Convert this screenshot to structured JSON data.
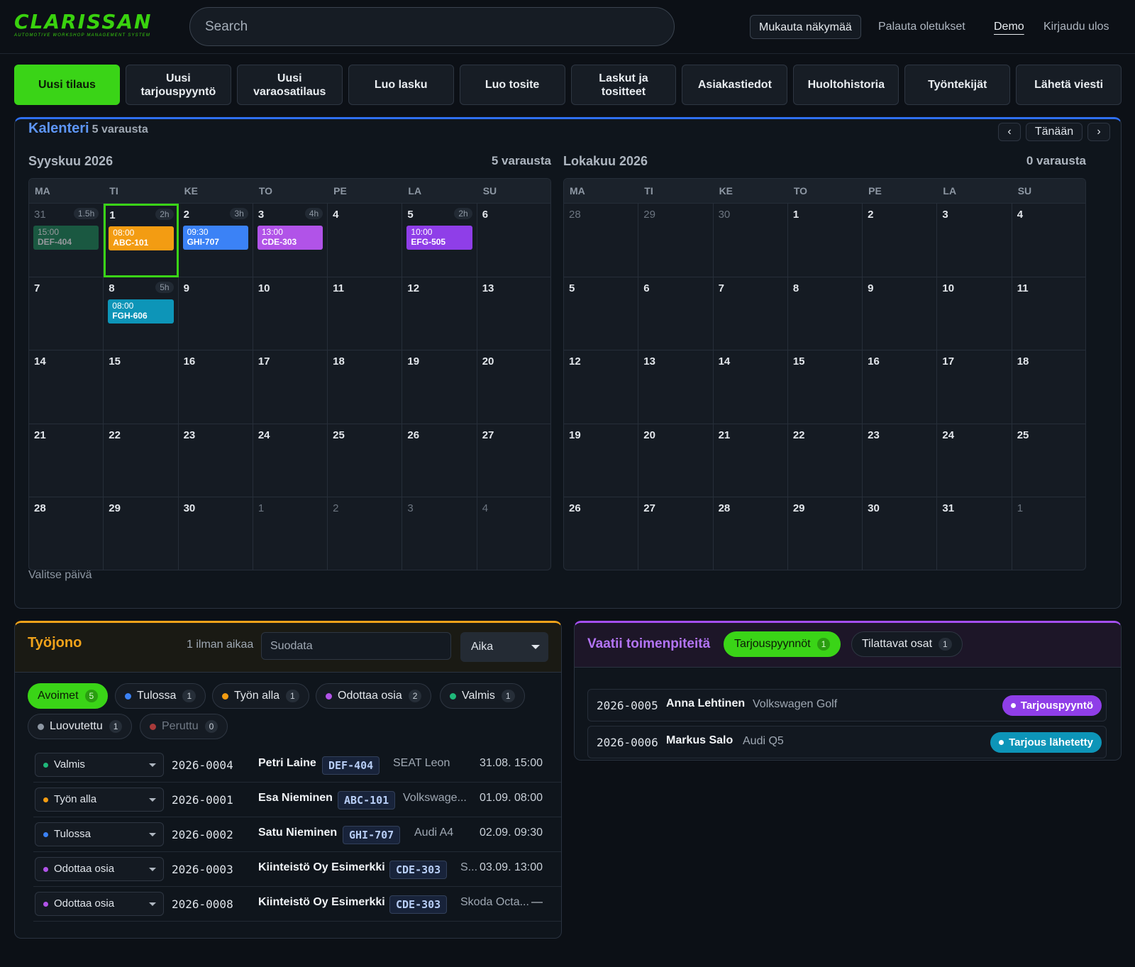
{
  "header": {
    "logo_text": "CLARISSAN",
    "logo_sub": "AUTOMOTIVE WORKSHOP MANAGEMENT SYSTEM",
    "search_placeholder": "Search",
    "customize_label": "Mukauta näkymää",
    "reset_label": "Palauta oletukset",
    "user_label": "Demo",
    "logout_label": "Kirjaudu ulos"
  },
  "actions": [
    "Uusi tilaus",
    "Uusi\ntarjouspyyntö",
    "Uusi\nvaraosatilaus",
    "Luo lasku",
    "Luo tosite",
    "Laskut ja\ntositteet",
    "Asiakastiedot",
    "Huoltohistoria",
    "Työntekijät",
    "Lähetä viesti"
  ],
  "calendar": {
    "title": "Kalenteri",
    "count_label": "5 varausta",
    "prev_label": "‹",
    "today_label": "Tänään",
    "next_label": "›",
    "weekdays": [
      "MA",
      "TI",
      "KE",
      "TO",
      "PE",
      "LA",
      "SU"
    ],
    "footer": "Valitse päivä",
    "months": [
      {
        "name": "Syyskuu 2026",
        "count": "5 varausta",
        "days": [
          "31",
          "1",
          "2",
          "3",
          "4",
          "5",
          "6",
          "7",
          "8",
          "9",
          "10",
          "11",
          "12",
          "13",
          "14",
          "15",
          "16",
          "17",
          "18",
          "19",
          "20",
          "21",
          "22",
          "23",
          "24",
          "25",
          "26",
          "27",
          "28",
          "29",
          "30",
          "1",
          "2",
          "3",
          "4"
        ],
        "outside": [
          0,
          31,
          32,
          33,
          34
        ],
        "selected": 1,
        "hours": {
          "0": "1.5h",
          "1": "2h",
          "2": "3h",
          "3": "4h",
          "5": "2h",
          "8": "5h"
        },
        "events": {
          "0": {
            "time": "15:00",
            "plate": "DEF-404",
            "color": "#1f8a5a",
            "dim": true
          },
          "1": {
            "time": "08:00",
            "plate": "ABC-101",
            "color": "#f39c12"
          },
          "2": {
            "time": "09:30",
            "plate": "GHI-707",
            "color": "#3b82f6"
          },
          "3": {
            "time": "13:00",
            "plate": "CDE-303",
            "color": "#b153e8"
          },
          "5": {
            "time": "10:00",
            "plate": "EFG-505",
            "color": "#8f3ee8"
          },
          "8": {
            "time": "08:00",
            "plate": "FGH-606",
            "color": "#0d95b8"
          }
        }
      },
      {
        "name": "Lokakuu 2026",
        "count": "0 varausta",
        "days": [
          "28",
          "29",
          "30",
          "1",
          "2",
          "3",
          "4",
          "5",
          "6",
          "7",
          "8",
          "9",
          "10",
          "11",
          "12",
          "13",
          "14",
          "15",
          "16",
          "17",
          "18",
          "19",
          "20",
          "21",
          "22",
          "23",
          "24",
          "25",
          "26",
          "27",
          "28",
          "29",
          "30",
          "31",
          "1"
        ],
        "outside": [
          0,
          1,
          2,
          34
        ],
        "selected": -1,
        "hours": {},
        "events": {}
      }
    ]
  },
  "workqueue": {
    "title": "Työjono",
    "no_time_label": "1 ilman aikaa",
    "filter_placeholder": "Suodata",
    "sort_label": "Aika",
    "chips": [
      {
        "label": "Avoimet",
        "count": "5",
        "dot": "",
        "on": true
      },
      {
        "label": "Tulossa",
        "count": "1",
        "dot": "#3b82f6"
      },
      {
        "label": "Työn alla",
        "count": "1",
        "dot": "#f39c12"
      },
      {
        "label": "Odottaa osia",
        "count": "2",
        "dot": "#b153e8"
      },
      {
        "label": "Valmis",
        "count": "1",
        "dot": "#1fb87a"
      },
      {
        "label": "Luovutettu",
        "count": "1",
        "dot": "#8d97a3"
      },
      {
        "label": "Peruttu",
        "count": "0",
        "dot": "#a83a3a",
        "off": true
      }
    ],
    "rows": [
      {
        "status": "Valmis",
        "dot": "#1fb87a",
        "no": "2026-0004",
        "name": "Petri Laine",
        "plate": "DEF-404",
        "car": "SEAT Leon",
        "time": "31.08. 15:00"
      },
      {
        "status": "Työn alla",
        "dot": "#f39c12",
        "no": "2026-0001",
        "name": "Esa Nieminen",
        "plate": "ABC-101",
        "car": "Volkswage...",
        "time": "01.09. 08:00"
      },
      {
        "status": "Tulossa",
        "dot": "#3b82f6",
        "no": "2026-0002",
        "name": "Satu Nieminen",
        "plate": "GHI-707",
        "car": "Audi A4",
        "time": "02.09. 09:30"
      },
      {
        "status": "Odottaa osia",
        "dot": "#b153e8",
        "no": "2026-0003",
        "name": "Kiinteistö Oy Esimerkki",
        "plate": "CDE-303",
        "car": "S...",
        "time": "03.09. 13:00"
      },
      {
        "status": "Odottaa osia",
        "dot": "#b153e8",
        "no": "2026-0008",
        "name": "Kiinteistö Oy Esimerkki",
        "plate": "CDE-303",
        "car": "Skoda Octa...",
        "time": "—"
      }
    ]
  },
  "actionpanel": {
    "title": "Vaatii toimenpiteitä",
    "tabs": [
      {
        "label": "Tarjouspyynnöt",
        "count": "1",
        "on": true
      },
      {
        "label": "Tilattavat osat",
        "count": "1"
      }
    ],
    "rows": [
      {
        "no": "2026-0005",
        "name": "Anna Lehtinen",
        "car": "Volkswagen Golf",
        "badge": "Tarjouspyyntö",
        "color": "#8f3ee8"
      },
      {
        "no": "2026-0006",
        "name": "Markus Salo",
        "car": "Audi Q5",
        "badge": "Tarjous lähetetty",
        "color": "#0d95b8"
      }
    ]
  }
}
